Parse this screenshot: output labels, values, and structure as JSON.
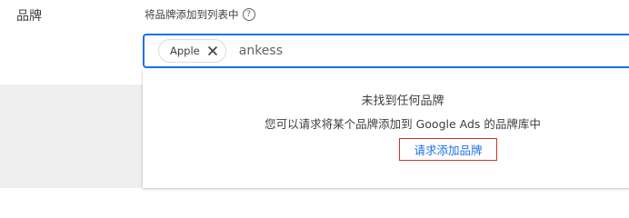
{
  "field": {
    "label": "品牌"
  },
  "instruction": {
    "text": "将品牌添加到列表中",
    "help_icon": "help-circle-icon",
    "help_glyph": "?"
  },
  "input": {
    "chips": [
      {
        "label": "Apple",
        "icon": "close-icon"
      }
    ],
    "value": "ankess"
  },
  "dropdown": {
    "title": "未找到任何品牌",
    "hint": "您可以请求将某个品牌添加到 Google Ads 的品牌库中",
    "request_link": "请求添加品牌"
  },
  "colors": {
    "accent": "#1a73e8",
    "highlight_border": "#d93025",
    "background_gray": "#efefef"
  }
}
